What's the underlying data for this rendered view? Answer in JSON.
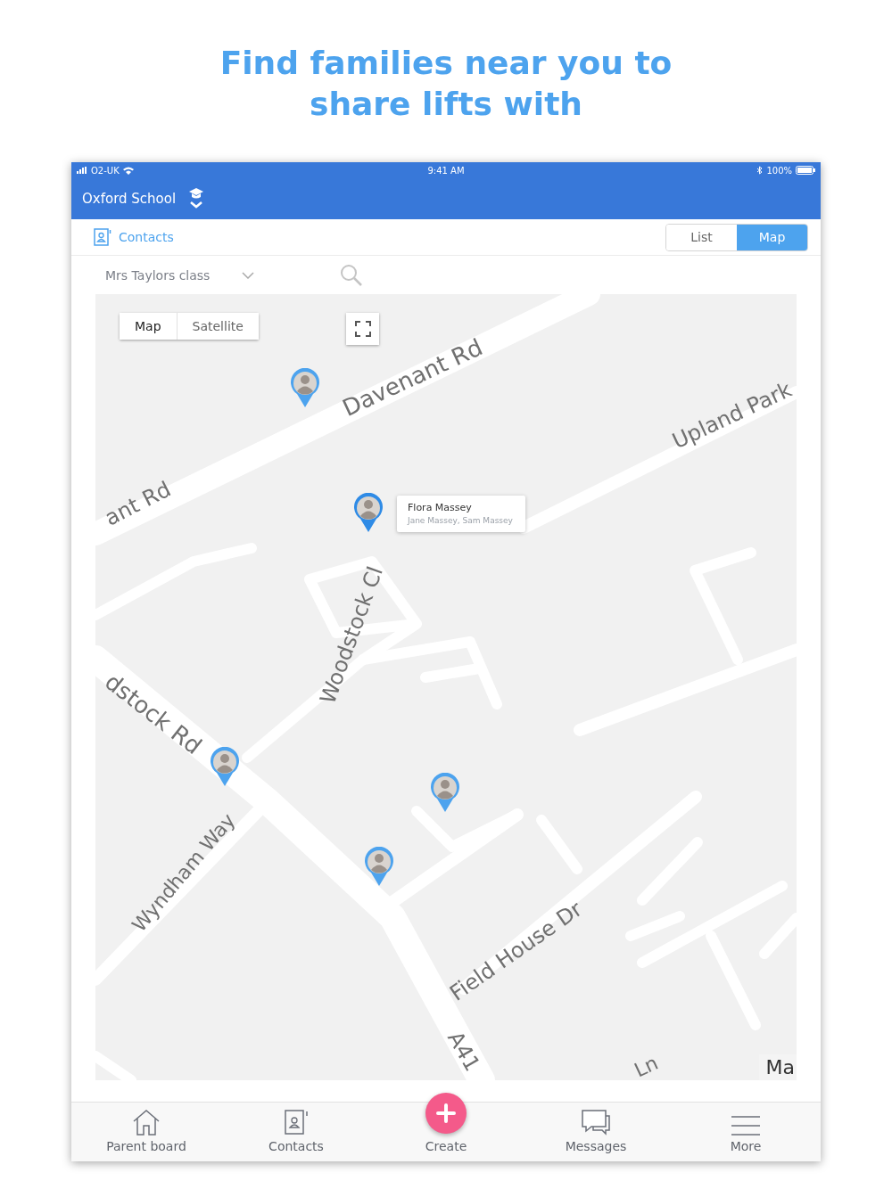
{
  "headline": "Find families near you to share lifts with",
  "status_bar": {
    "carrier": "O2-UK",
    "time": "9:41 AM",
    "battery": "100%"
  },
  "nav": {
    "school": "Oxford School"
  },
  "header": {
    "title": "Contacts",
    "view_toggle": [
      {
        "label": "List",
        "selected": false
      },
      {
        "label": "Map",
        "selected": true
      }
    ]
  },
  "filter": {
    "group": "Mrs Taylors class"
  },
  "map": {
    "type_toggle": [
      {
        "label": "Map",
        "selected": true
      },
      {
        "label": "Satellite",
        "selected": false
      }
    ],
    "road_labels": [
      "Davenant Rd",
      "ant Rd",
      "Upland Park",
      "Woodstock Cl",
      "dstock Rd",
      "Wyndham Way",
      "Field House Dr",
      "A41",
      "Ln"
    ],
    "attribution": "Ma",
    "pins": [
      {
        "selected": false
      },
      {
        "selected": true,
        "name": "Flora Massey",
        "members": "Jane Massey, Sam Massey"
      },
      {
        "selected": false
      },
      {
        "selected": false
      },
      {
        "selected": false
      }
    ]
  },
  "tab_bar": [
    {
      "label": "Parent board",
      "kind": "home"
    },
    {
      "label": "Contacts",
      "kind": "contacts"
    },
    {
      "label": "Create",
      "kind": "create"
    },
    {
      "label": "Messages",
      "kind": "messages"
    },
    {
      "label": "More",
      "kind": "menu"
    }
  ]
}
